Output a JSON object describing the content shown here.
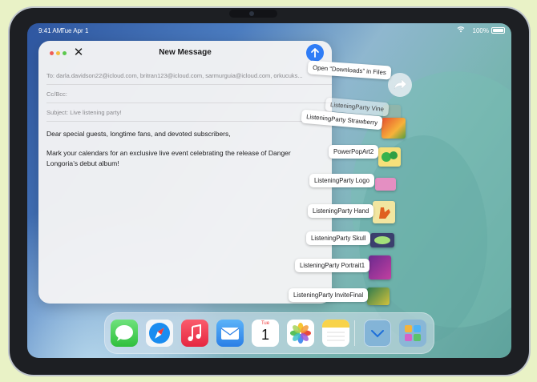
{
  "status_bar": {
    "time": "9:41 AM",
    "date": "Tue Apr 1",
    "battery": "100%"
  },
  "mail": {
    "title": "New Message",
    "to_label": "To:",
    "to_value": "darla.davidson22@icloud.com, britran123@icloud.com, sarmurguia@icloud.com, orkucuks...",
    "cc_label": "Cc/Bcc:",
    "subject_label": "Subject:",
    "subject_value": "Live listening party!",
    "body": [
      "Dear special guests, longtime fans, and devoted subscribers,",
      "Mark your calendars for an exclusive live event celebrating the release of Danger Longoria’s debut album!"
    ]
  },
  "drag": {
    "open_in_files": "Open “Downloads” in Files",
    "items": [
      "ListeningParty Vine",
      "ListeningParty Strawberry",
      "PowerPopArt2",
      "ListeningParty Logo",
      "ListeningParty Hand",
      "ListeningParty Skull",
      "ListeningParty Portrait1",
      "ListeningParty InviteFinal"
    ]
  },
  "dock": {
    "apps": [
      "messages-app",
      "safari-app",
      "music-app",
      "mail-app",
      "calendar-app",
      "photos-app",
      "notes-app",
      "downloads-folder",
      "app-library"
    ],
    "calendar_day": "Tue",
    "calendar_date": "1"
  },
  "colors": {
    "accent": "#2f7cf6",
    "dock_red": "#e33a4b"
  }
}
